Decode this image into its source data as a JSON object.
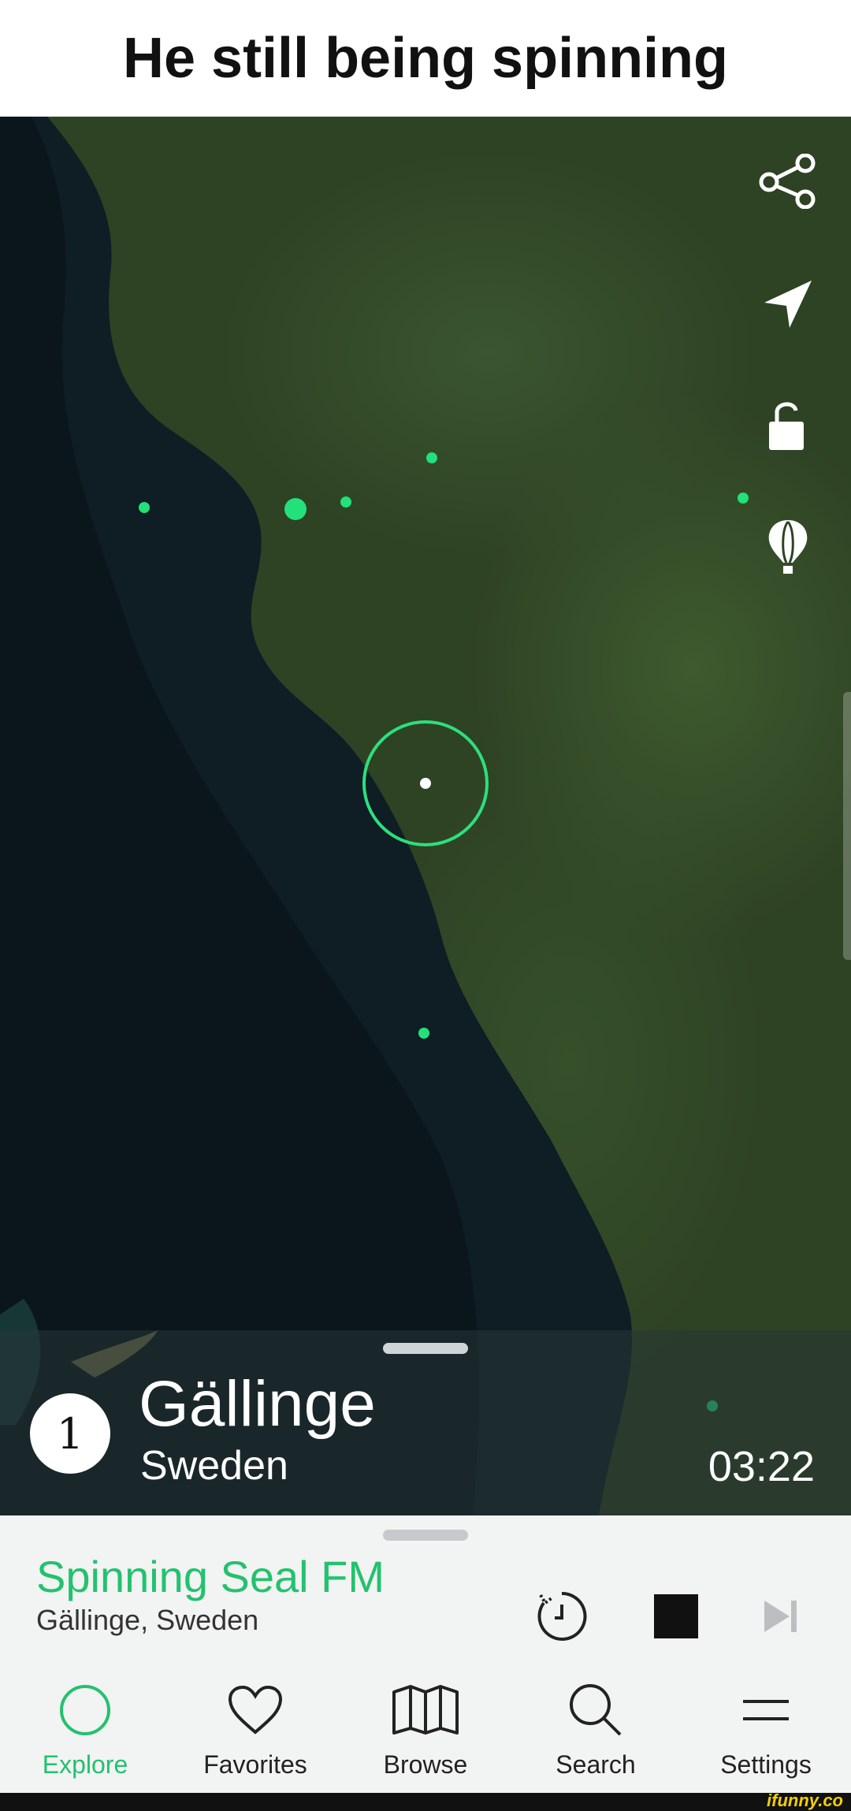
{
  "caption": "He still being spinning",
  "map": {
    "accent_color": "#2be07d"
  },
  "side_icons": [
    "share-icon",
    "navigation-arrow-icon",
    "unlock-icon",
    "balloon-icon"
  ],
  "station_card": {
    "number": "1",
    "city": "Gällinge",
    "country": "Sweden",
    "timer": "03:22"
  },
  "player": {
    "station_name": "Spinning Seal FM",
    "station_location": "Gällinge, Sweden",
    "controls": [
      "sleep-timer-icon",
      "stop-icon",
      "skip-next-icon"
    ]
  },
  "nav": {
    "items": [
      {
        "label": "Explore",
        "icon": "circle-icon",
        "active": true
      },
      {
        "label": "Favorites",
        "icon": "heart-icon",
        "active": false
      },
      {
        "label": "Browse",
        "icon": "map-icon",
        "active": false
      },
      {
        "label": "Search",
        "icon": "search-icon",
        "active": false
      },
      {
        "label": "Settings",
        "icon": "menu-icon",
        "active": false
      }
    ]
  },
  "watermark": "ifunny.co",
  "colors": {
    "accent": "#23c26e",
    "dot": "#22e07a"
  }
}
